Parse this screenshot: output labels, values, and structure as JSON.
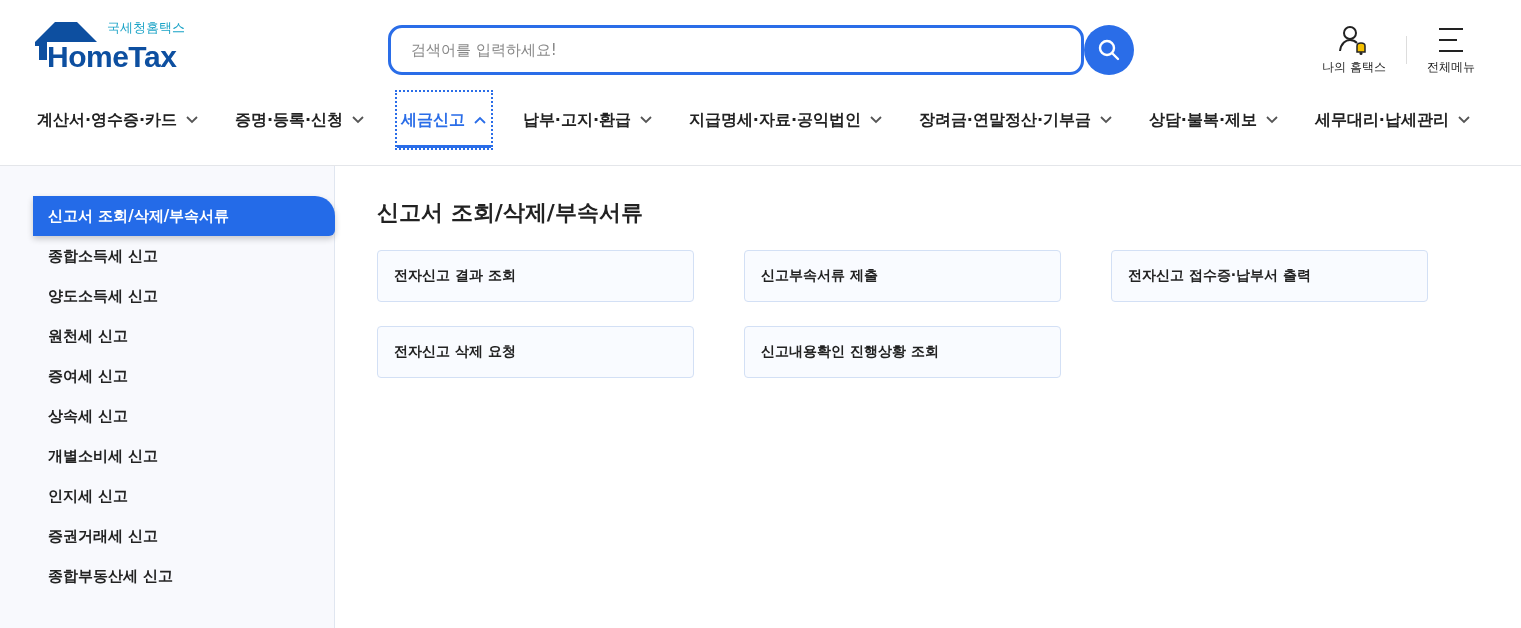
{
  "logo": {
    "subtitle": "국세청홈택스",
    "title": "HomeTax"
  },
  "search": {
    "placeholder": "검색어를 입력하세요!"
  },
  "utility": [
    {
      "kind": "user",
      "label": "나의 홈택스"
    },
    {
      "kind": "menu",
      "label": "전체메뉴"
    }
  ],
  "nav": [
    {
      "label": "계산서·영수증·카드",
      "selected": false
    },
    {
      "label": "증명·등록·신청",
      "selected": false
    },
    {
      "label": "세금신고",
      "selected": true
    },
    {
      "label": "납부·고지·환급",
      "selected": false
    },
    {
      "label": "지급명세·자료·공익법인",
      "selected": false
    },
    {
      "label": "장려금·연말정산·기부금",
      "selected": false
    },
    {
      "label": "상담·불복·제보",
      "selected": false
    },
    {
      "label": "세무대리·납세관리",
      "selected": false
    }
  ],
  "sidebar": [
    {
      "label": "신고서 조회/삭제/부속서류",
      "selected": true
    },
    {
      "label": "종합소득세 신고",
      "selected": false
    },
    {
      "label": "양도소득세 신고",
      "selected": false
    },
    {
      "label": "원천세 신고",
      "selected": false
    },
    {
      "label": "증여세 신고",
      "selected": false
    },
    {
      "label": "상속세 신고",
      "selected": false
    },
    {
      "label": "개별소비세 신고",
      "selected": false
    },
    {
      "label": "인지세 신고",
      "selected": false
    },
    {
      "label": "증권거래세 신고",
      "selected": false
    },
    {
      "label": "종합부동산세 신고",
      "selected": false
    }
  ],
  "content": {
    "title": "신고서 조회/삭제/부속서류",
    "cards": [
      "전자신고 결과 조회",
      "신고부속서류 제출",
      "전자신고 접수증·납부서 출력",
      "전자신고 삭제 요청",
      "신고내용확인 진행상황 조회"
    ]
  }
}
